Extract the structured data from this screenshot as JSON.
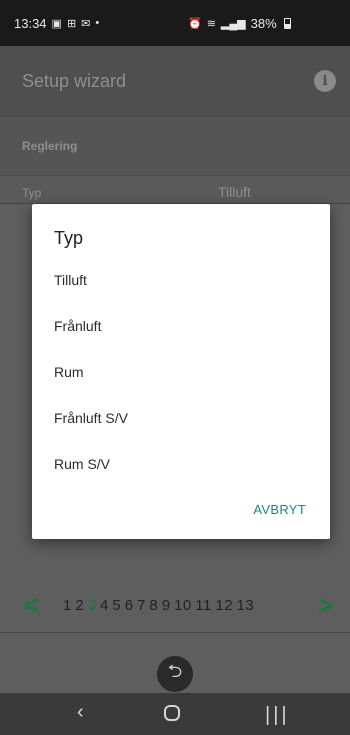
{
  "status_bar": {
    "time": "13:34",
    "battery": "38%",
    "left_icons": [
      "gallery-icon",
      "teams-icon",
      "outlook-icon",
      "dot-icon"
    ],
    "right_icons": [
      "alarm-icon",
      "wifi-icon",
      "signal-icon",
      "battery-icon"
    ]
  },
  "appbar": {
    "title": "Setup wizard"
  },
  "section": {
    "label": "Reglering"
  },
  "row": {
    "label": "Typ",
    "value": "Tilluft"
  },
  "pager": {
    "pages": [
      "1",
      "2",
      "3",
      "4",
      "5",
      "6",
      "7",
      "8",
      "9",
      "10",
      "11",
      "12",
      "13"
    ],
    "current_page": "3",
    "prev": "<",
    "next": ">"
  },
  "dialog": {
    "title": "Typ",
    "options": [
      "Tilluft",
      "Frånluft",
      "Rum",
      "Frånluft S/V",
      "Rum S/V"
    ],
    "cancel_label": "AVBRYT"
  },
  "colors": {
    "accent_green": "#1a7a3e",
    "button_teal": "#1b8a78"
  }
}
